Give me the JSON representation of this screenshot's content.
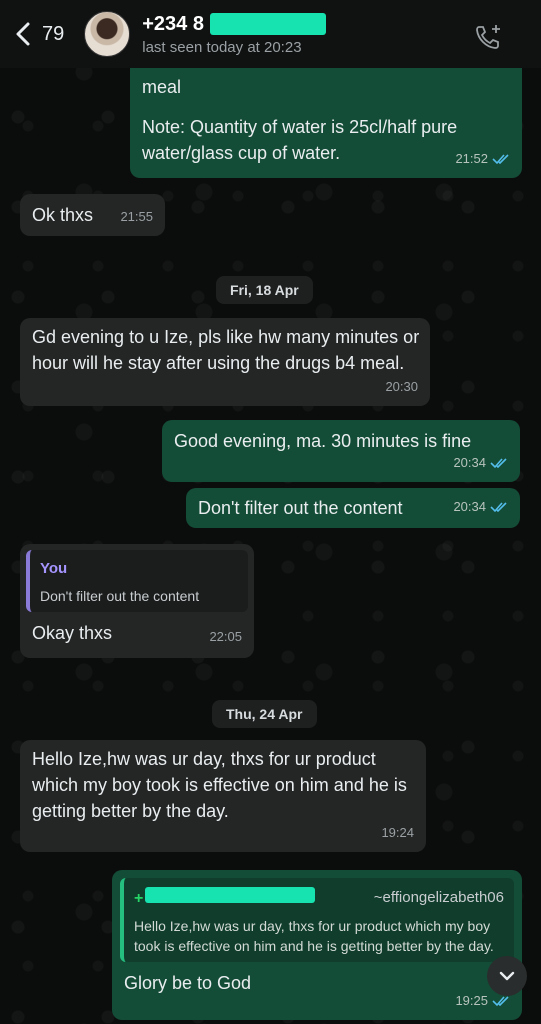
{
  "header": {
    "unread_count": "79",
    "contact_name": "+234 8",
    "last_seen": "last seen today at 20:23"
  },
  "messages": [
    {
      "text_line1": "meal",
      "text_line2": "Note: Quantity of water is 25cl/half pure water/glass cup of water.",
      "time": "21:52"
    },
    {
      "text": "Ok thxs",
      "time": "21:55"
    },
    {
      "date": "Fri, 18 Apr"
    },
    {
      "text": "Gd evening to u Ize, pls like hw many minutes or hour will he stay after using the drugs b4 meal.",
      "time": "20:30"
    },
    {
      "text": "Good evening, ma. 30 minutes is fine",
      "time": "20:34"
    },
    {
      "text": "Don't filter out the content",
      "time": "20:34"
    },
    {
      "quote_author": "You",
      "quote_text": "Don't filter out the content",
      "text": "Okay thxs",
      "time": "22:05"
    },
    {
      "date": "Thu, 24 Apr"
    },
    {
      "text": "Hello Ize,hw was ur day, thxs for ur product which my boy took is effective on him and he is getting better by the day.",
      "time": "19:24"
    },
    {
      "quote_prefix": "+",
      "quote_handle": "~effiongelizabeth06",
      "quote_text": "Hello Ize,hw was ur day, thxs for ur product which my boy took is effective on him and he is getting better by the day.",
      "text": "Glory be to God",
      "time": "19:25"
    }
  ],
  "colors": {
    "outgoing_bubble": "#144d37",
    "incoming_bubble": "#242626",
    "read_ticks": "#53bdeb",
    "quote_you": "#a695ff",
    "redaction": "#17e3b0"
  },
  "icons": [
    "back-arrow-icon",
    "add-call-icon",
    "double-check-icon",
    "chevron-down-icon"
  ]
}
